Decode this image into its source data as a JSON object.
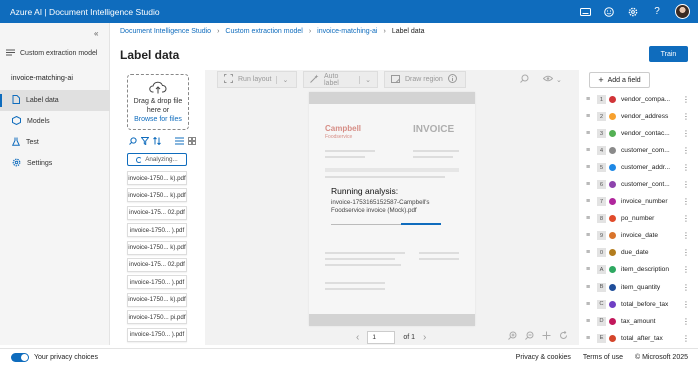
{
  "app": {
    "title": "Azure AI | Document Intelligence Studio",
    "header_icons": [
      "keyboard-icon",
      "smiley-icon",
      "gear-icon",
      "help-icon"
    ]
  },
  "nav": {
    "back_label": "Custom extraction model",
    "project": "invoice-matching-ai",
    "items": [
      {
        "label": "Label data",
        "icon": "document-icon",
        "active": true
      },
      {
        "label": "Models",
        "icon": "cube-icon",
        "active": false
      },
      {
        "label": "Test",
        "icon": "flask-icon",
        "active": false
      },
      {
        "label": "Settings",
        "icon": "gear-icon",
        "active": false
      }
    ]
  },
  "breadcrumb": [
    "Document Intelligence Studio",
    "Custom extraction model",
    "invoice-matching-ai",
    "Label data"
  ],
  "page": {
    "title": "Label data",
    "train_label": "Train"
  },
  "dropzone": {
    "line1": "Drag & drop file",
    "line2": "here or",
    "link": "Browse for files"
  },
  "analyzing_label": "Analyzing...",
  "files": [
    "invoice-1750... k).pdf",
    "invoice-1750... k).pdf",
    "invoice-175... 02.pdf",
    "invoice-1750... ).pdf",
    "invoice-1750... k).pdf",
    "invoice-175... 02.pdf",
    "invoice-1750... ).pdf",
    "invoice-1750... k).pdf",
    "invoice-1750... pi.pdf",
    "invoice-1750... ).pdf"
  ],
  "toolbar": {
    "run_layout": "Run layout",
    "auto_label": "Auto label",
    "draw_region": "Draw region"
  },
  "document": {
    "brand": "Campbell",
    "brand_sub": "Foodservice",
    "invoice_heading": "INVOICE"
  },
  "analysis": {
    "heading": "Running analysis:",
    "file": "invoice-1753165152587-Campbell's Foodservice invoice (Mock).pdf"
  },
  "pager": {
    "current": "1",
    "of_label": "of 1"
  },
  "fields_panel": {
    "add_label": "Add a field",
    "fields": [
      {
        "key": "1",
        "name": "vendor_compa...",
        "color": "#d13438"
      },
      {
        "key": "2",
        "name": "vendor_address",
        "color": "#f7a12e"
      },
      {
        "key": "3",
        "name": "vendor_contac...",
        "color": "#54b054"
      },
      {
        "key": "4",
        "name": "customer_com...",
        "color": "#8a8a8a"
      },
      {
        "key": "5",
        "name": "customer_addr...",
        "color": "#1e88e5"
      },
      {
        "key": "6",
        "name": "customer_cont...",
        "color": "#8e44ad"
      },
      {
        "key": "7",
        "name": "invoice_number",
        "color": "#b0269c"
      },
      {
        "key": "8",
        "name": "po_number",
        "color": "#e14b2b"
      },
      {
        "key": "9",
        "name": "invoice_date",
        "color": "#d9742c"
      },
      {
        "key": "0",
        "name": "due_date",
        "color": "#b37d1e"
      },
      {
        "key": "A",
        "name": "item_description",
        "color": "#2ea861"
      },
      {
        "key": "B",
        "name": "item_quantity",
        "color": "#1f4e9a"
      },
      {
        "key": "C",
        "name": "total_before_tax",
        "color": "#6f3fc4"
      },
      {
        "key": "D",
        "name": "tax_amount",
        "color": "#c2185b"
      },
      {
        "key": "E",
        "name": "total_after_tax",
        "color": "#d4452b"
      }
    ]
  },
  "footer": {
    "privacy": "Your privacy choices",
    "links": [
      "Privacy & cookies",
      "Terms of use",
      "© Microsoft 2025"
    ]
  }
}
